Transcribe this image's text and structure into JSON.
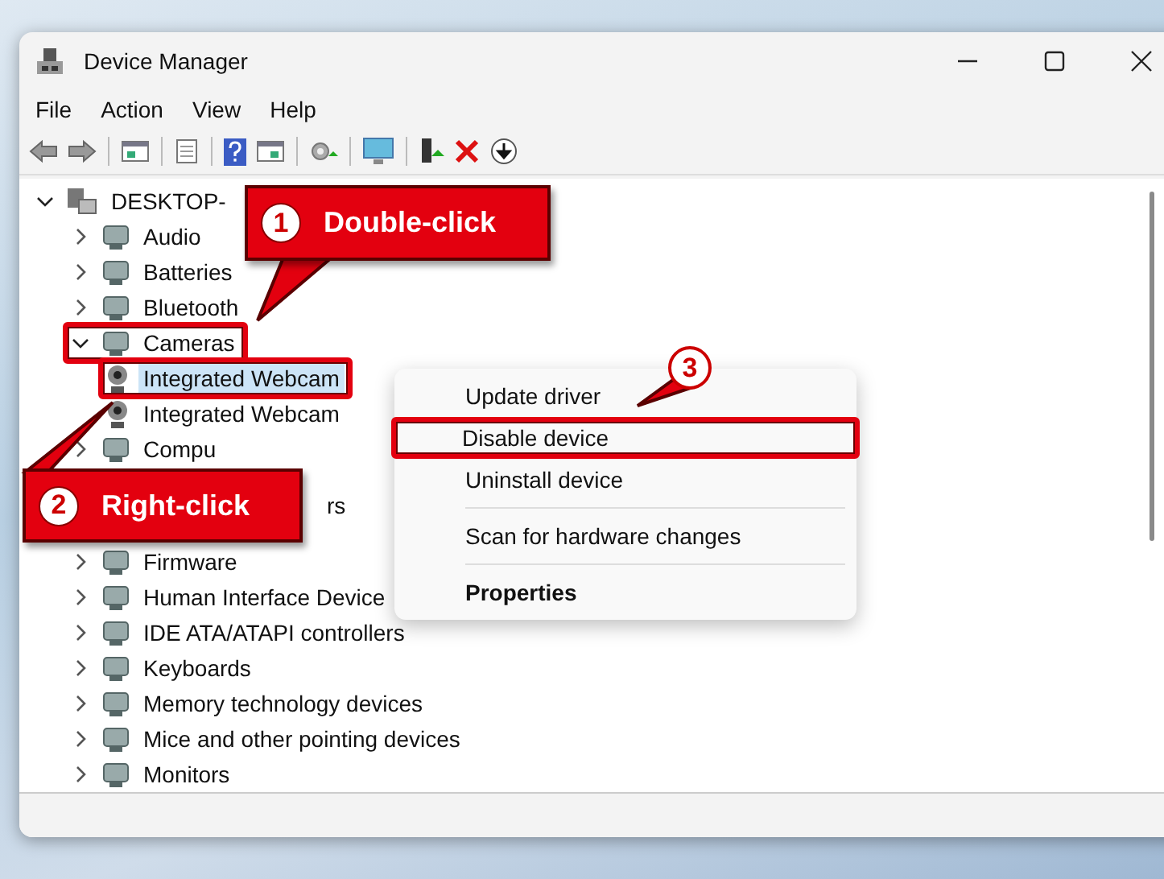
{
  "window": {
    "title": "Device Manager"
  },
  "menu_bar": [
    "File",
    "Action",
    "View",
    "Help"
  ],
  "tree": {
    "label": "DESKTOP-",
    "expanded": true,
    "selected": false,
    "highlighted": false,
    "children": [
      {
        "kind": "category",
        "label": "Audio",
        "expanded": false,
        "selected": false,
        "highlighted": false
      },
      {
        "kind": "category",
        "label": "Batteries",
        "expanded": false,
        "selected": false,
        "highlighted": false
      },
      {
        "kind": "category",
        "label": "Bluetooth",
        "expanded": false,
        "selected": false,
        "highlighted": false
      },
      {
        "kind": "category",
        "label": "Cameras",
        "expanded": true,
        "selected": false,
        "highlighted": true,
        "children": [
          {
            "kind": "device",
            "label": "Integrated Webcam",
            "selected": true,
            "highlighted": true
          },
          {
            "kind": "device",
            "label": "Integrated Webcam",
            "selected": false,
            "highlighted": false
          }
        ]
      },
      {
        "kind": "category",
        "label": "Compu",
        "expanded": false,
        "selected": false,
        "highlighted": false
      },
      {
        "kind": "partial",
        "label": "rs",
        "selected": false
      },
      {
        "kind": "category",
        "label": "Firmware",
        "expanded": false,
        "selected": false,
        "highlighted": false
      },
      {
        "kind": "category",
        "label": "Human Interface Device",
        "expanded": false,
        "selected": false,
        "highlighted": false
      },
      {
        "kind": "category",
        "label": "IDE ATA/ATAPI controllers",
        "expanded": false,
        "selected": false,
        "highlighted": false
      },
      {
        "kind": "category",
        "label": "Keyboards",
        "expanded": false,
        "selected": false,
        "highlighted": false
      },
      {
        "kind": "category",
        "label": "Memory technology devices",
        "expanded": false,
        "selected": false,
        "highlighted": false
      },
      {
        "kind": "category",
        "label": "Mice and other pointing devices",
        "expanded": false,
        "selected": false,
        "highlighted": false
      },
      {
        "kind": "category",
        "label": "Monitors",
        "expanded": false,
        "selected": false,
        "highlighted": false
      }
    ]
  },
  "context_menu": [
    {
      "kind": "item",
      "label": "Update driver",
      "highlighted": false
    },
    {
      "kind": "item",
      "label": "Disable device",
      "highlighted": true
    },
    {
      "kind": "item",
      "label": "Uninstall device",
      "highlighted": false
    },
    {
      "kind": "separator"
    },
    {
      "kind": "item",
      "label": "Scan for hardware changes",
      "highlighted": false
    },
    {
      "kind": "separator"
    },
    {
      "kind": "default",
      "label": "Properties",
      "highlighted": false
    }
  ],
  "callouts": [
    {
      "number": "1",
      "text": "Double-click"
    },
    {
      "number": "2",
      "text": "Right-click"
    },
    {
      "number": "3"
    }
  ]
}
